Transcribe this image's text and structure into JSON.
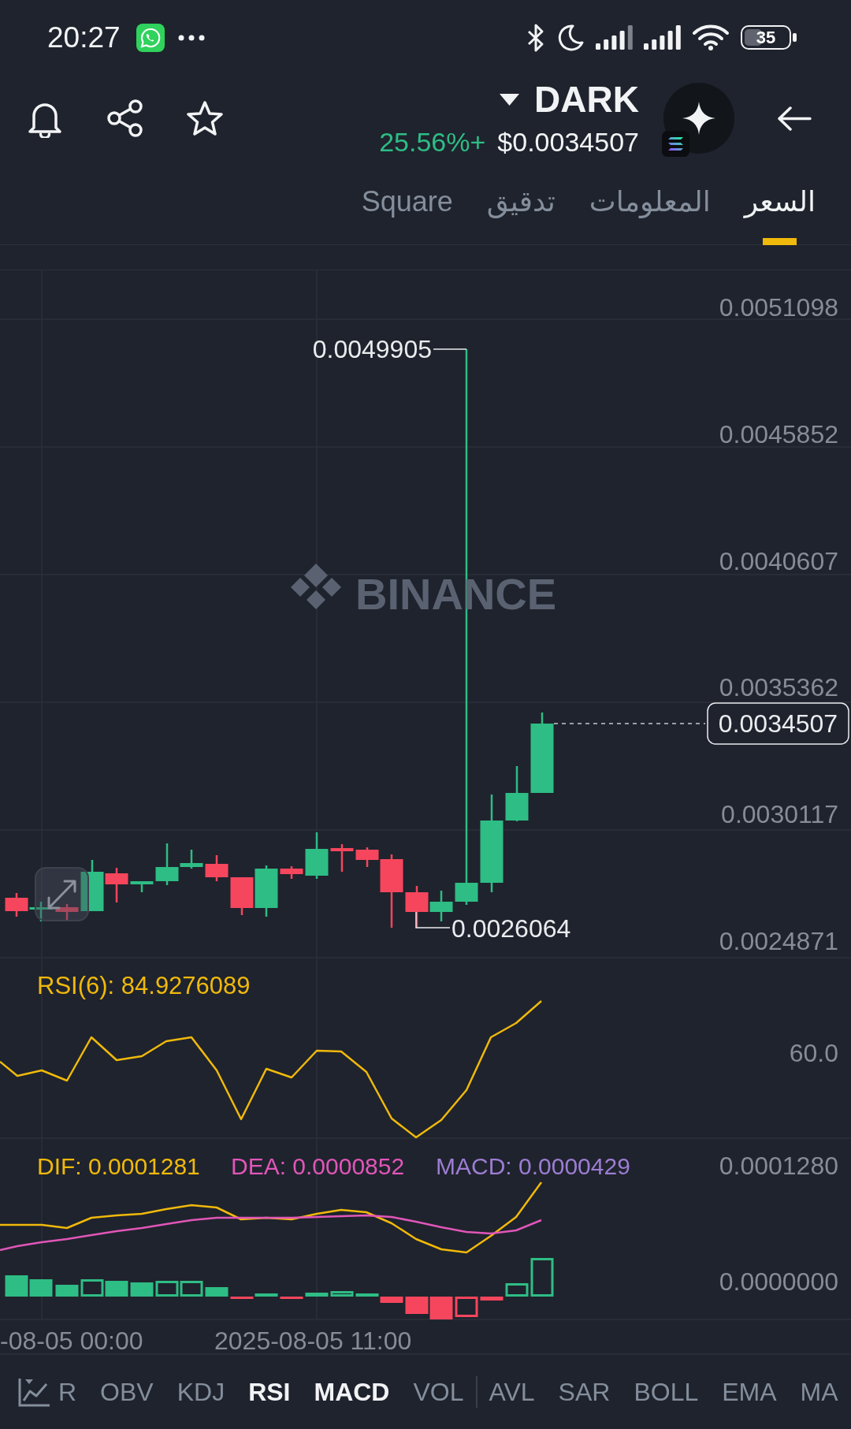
{
  "status_bar": {
    "time": "20:27",
    "battery": "35"
  },
  "header": {
    "symbol": "DARK",
    "change": "25.56%+",
    "price": "$0.0034507"
  },
  "tabs": [
    {
      "label": "السعر",
      "selected": true
    },
    {
      "label": "المعلومات",
      "selected": false
    },
    {
      "label": "تدقيق",
      "selected": false
    },
    {
      "label": "Square",
      "selected": false
    }
  ],
  "price_chart": {
    "watermark": "BINANCE",
    "price_axis": [
      "0.0051098",
      "0.0045852",
      "0.0040607",
      "0.0035362",
      "0.0030117",
      "0.0024871"
    ],
    "high_label": "0.0049905",
    "low_label": "0.0026064",
    "current_price": "0.0034507"
  },
  "rsi_panel": {
    "label": "RSI(6): 84.9276089",
    "axis": [
      "60.0"
    ]
  },
  "macd_panel": {
    "labels": [
      {
        "text": "DIF: 0.0001281",
        "color": "#f0b90b"
      },
      {
        "text": "DEA: 0.0000852",
        "color": "#e056b8"
      },
      {
        "text": "MACD: 0.0000429",
        "color": "#9c7dd3"
      }
    ],
    "axis": [
      "0.0001280",
      "0.0000000"
    ]
  },
  "time_axis": [
    "-08-05 00:00",
    "2025-08-05 11:00"
  ],
  "indicator_bar": {
    "sub": [
      {
        "label": "R",
        "selected": false
      },
      {
        "label": "OBV",
        "selected": false
      },
      {
        "label": "KDJ",
        "selected": false
      },
      {
        "label": "RSI",
        "selected": true
      },
      {
        "label": "MACD",
        "selected": true
      },
      {
        "label": "VOL",
        "selected": false
      }
    ],
    "main": [
      {
        "label": "AVL",
        "selected": false
      },
      {
        "label": "SAR",
        "selected": false
      },
      {
        "label": "BOLL",
        "selected": false
      },
      {
        "label": "EMA",
        "selected": false
      },
      {
        "label": "MA",
        "selected": false
      }
    ]
  }
}
